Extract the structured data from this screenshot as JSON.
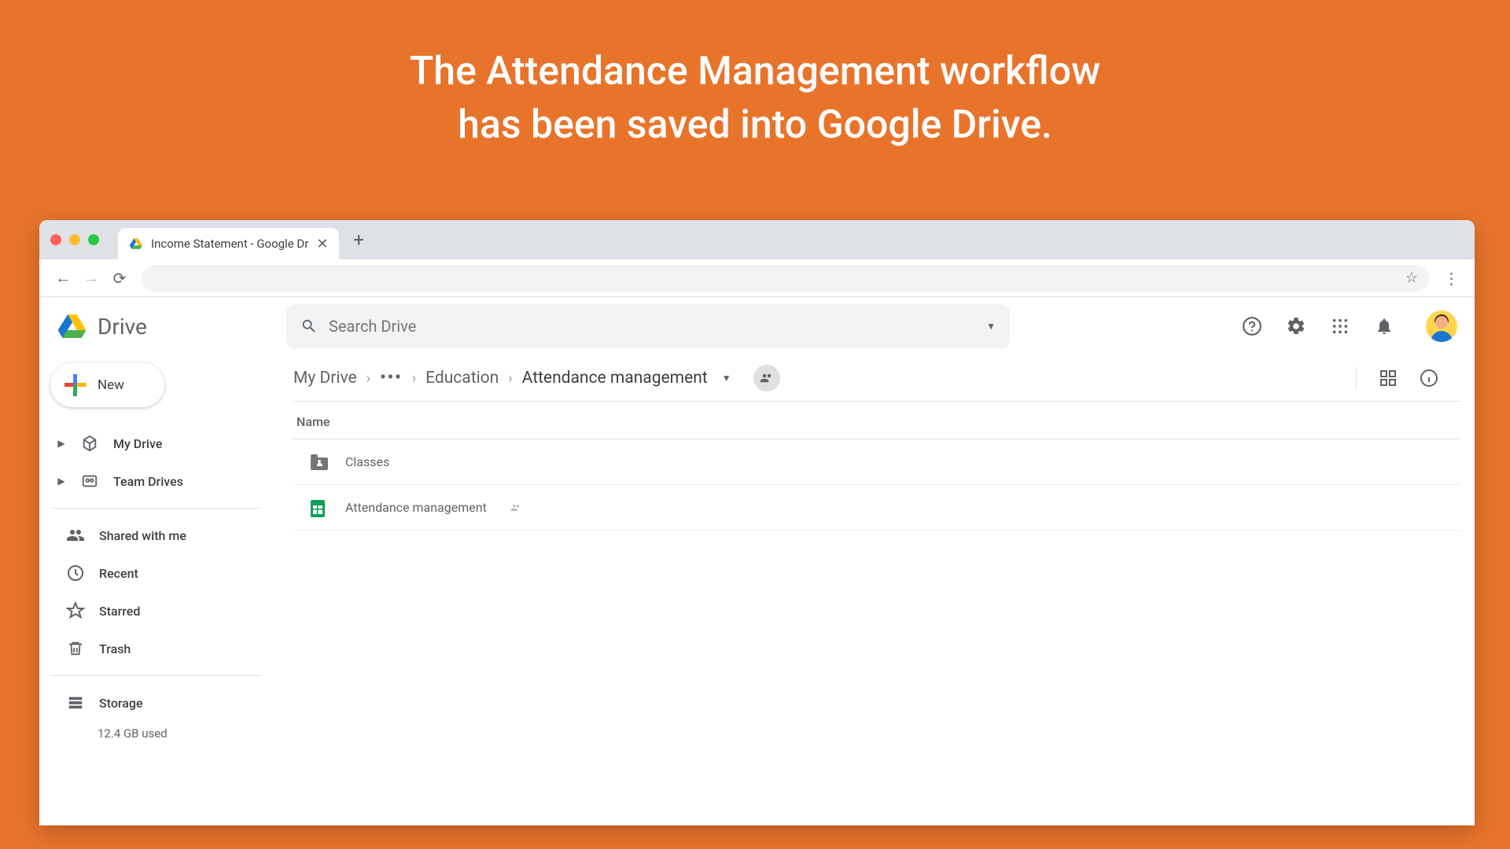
{
  "banner": {
    "line1": "The Attendance Management workflow",
    "line2": "has been saved into Google Drive."
  },
  "browser": {
    "tab_title": "Income Statement - Google Dr"
  },
  "drive": {
    "product_name": "Drive",
    "search_placeholder": "Search Drive",
    "new_button": "New",
    "sidebar": {
      "my_drive": "My Drive",
      "team_drives": "Team Drives",
      "shared_with_me": "Shared with me",
      "recent": "Recent",
      "starred": "Starred",
      "trash": "Trash",
      "storage": "Storage",
      "storage_used": "12.4 GB used"
    },
    "breadcrumb": {
      "root": "My Drive",
      "mid": "Education",
      "current": "Attendance management"
    },
    "list_header_name": "Name",
    "files": [
      {
        "name": "Classes",
        "type": "folder"
      },
      {
        "name": "Attendance management",
        "type": "sheets",
        "shared": true
      }
    ]
  }
}
